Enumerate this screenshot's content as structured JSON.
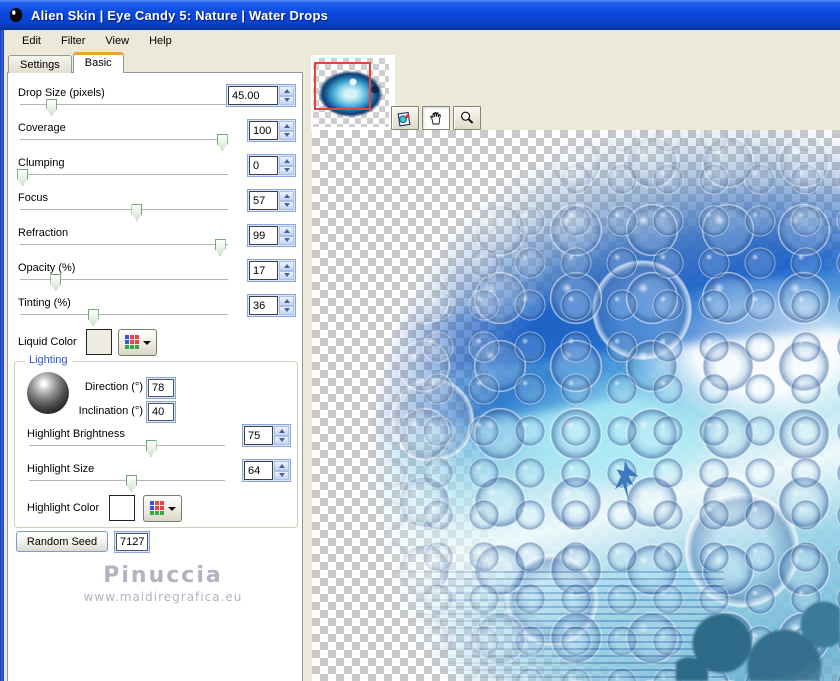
{
  "window": {
    "title": "Alien Skin  |  Eye Candy 5: Nature  |  Water Drops"
  },
  "menu": {
    "items": [
      "Edit",
      "Filter",
      "View",
      "Help"
    ]
  },
  "tabs": {
    "settings": "Settings",
    "basic": "Basic"
  },
  "panel": {
    "sliders": [
      {
        "label": "Drop Size (pixels)",
        "value": "45.00",
        "pos": "15%"
      },
      {
        "label": "Coverage",
        "value": "100",
        "pos": "97%"
      },
      {
        "label": "Clumping",
        "value": "0",
        "pos": "1%"
      },
      {
        "label": "Focus",
        "value": "57",
        "pos": "56%"
      },
      {
        "label": "Refraction",
        "value": "99",
        "pos": "96%"
      },
      {
        "label": "Opacity (%)",
        "value": "17",
        "pos": "17%"
      },
      {
        "label": "Tinting (%)",
        "value": "36",
        "pos": "35%"
      }
    ],
    "liquid_color": {
      "label": "Liquid Color",
      "swatch_color": "#eeebdf"
    },
    "lighting": {
      "title": "Lighting",
      "direction_label": "Direction (°)",
      "direction_value": "78",
      "inclination_label": "Inclination (°)",
      "inclination_value": "40",
      "highlight_brightness": {
        "label": "Highlight Brightness",
        "value": "75",
        "pos": "62%"
      },
      "highlight_size": {
        "label": "Highlight Size",
        "value": "64",
        "pos": "52%"
      },
      "highlight_color": {
        "label": "Highlight Color",
        "swatch_color": "#ffffff"
      }
    },
    "random_seed": {
      "button_label": "Random Seed",
      "value": "7127"
    },
    "watermark": {
      "line1": "Pinuccia",
      "line2": "www.maidiregrafica.eu"
    }
  },
  "preview": {
    "toolbar_icons": [
      "preview-compare-icon",
      "hand-tool-icon",
      "zoom-tool-icon"
    ],
    "thumbnail_selection_color": "#e8423e"
  },
  "colors": {
    "titlebar_blue": "#0c4ae0",
    "dialog_beige": "#ece9d8",
    "tab_accent_orange": "#f0a030",
    "checker_gray": "#c9c9c9",
    "lighting_label_blue": "#2a52cc",
    "watermark_gray": "#b2b2c2"
  }
}
